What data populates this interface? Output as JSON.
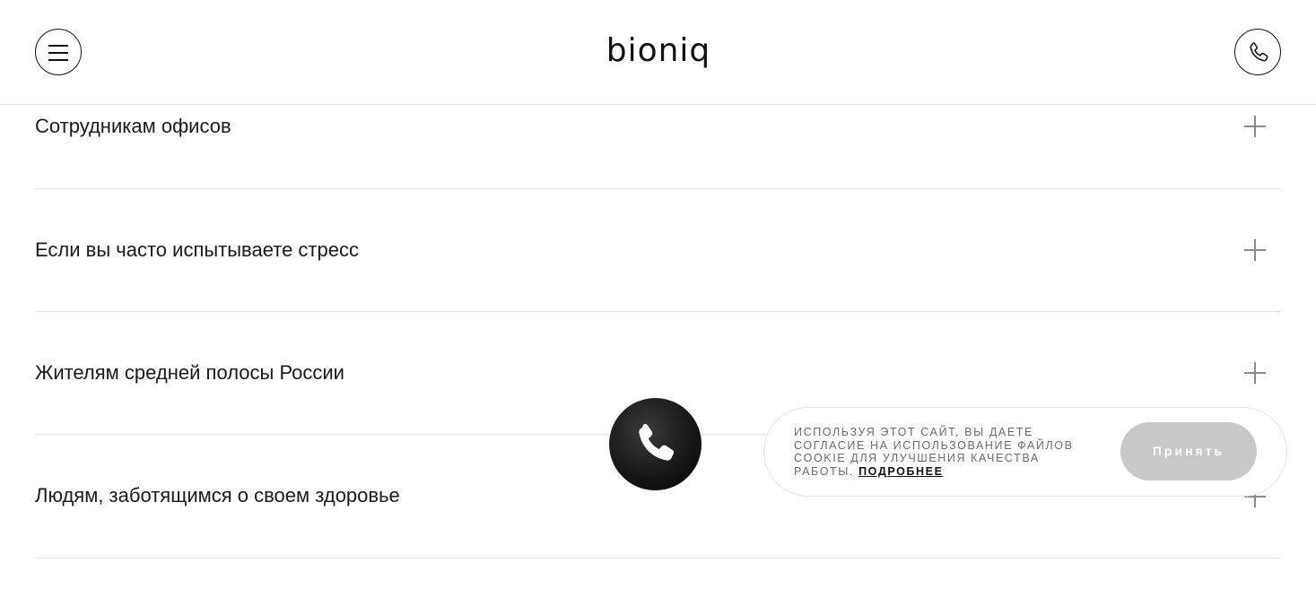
{
  "header": {
    "logo_text": "bioniq",
    "menu_icon": "hamburger-icon",
    "call_icon": "phone-icon"
  },
  "accordion": {
    "items": [
      {
        "title": "Сотрудникам офисов",
        "icon": "plus-icon"
      },
      {
        "title": "Если вы часто испытываете стресс",
        "icon": "plus-icon"
      },
      {
        "title": "Жителям средней полосы России",
        "icon": "plus-icon"
      },
      {
        "title": "Людям, заботящимся о своем здоровье",
        "icon": "plus-icon"
      }
    ]
  },
  "floating_call": {
    "icon": "phone-icon"
  },
  "cookie": {
    "text": "Используя этот сайт, вы даете согласие на использование файлов cookie для улучшения качества работы.",
    "link": "Подробнее",
    "accept": "Принять"
  },
  "colors": {
    "text": "#1a1a1a",
    "divider": "#e3e3e3",
    "accept_button": "#c8c8c8",
    "float_button": "#111111"
  }
}
